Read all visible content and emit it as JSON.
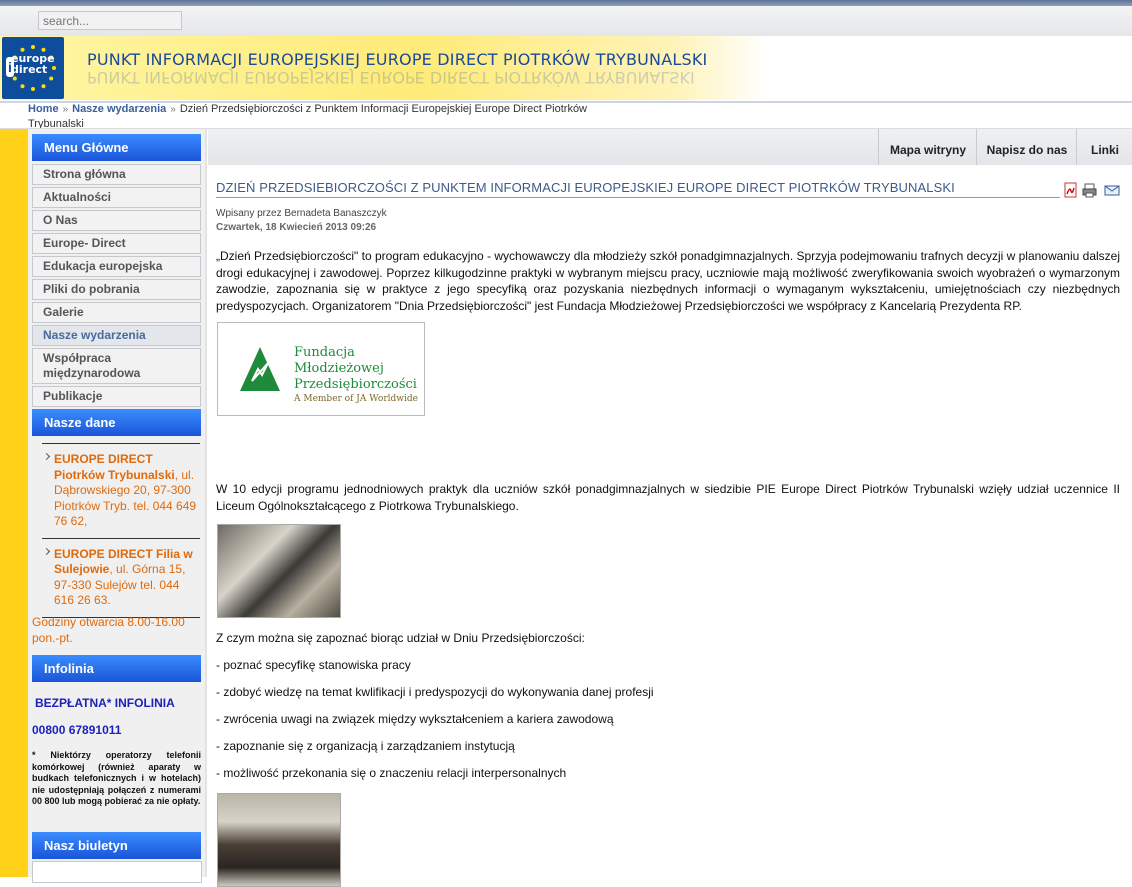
{
  "search": {
    "placeholder": "search..."
  },
  "logo": {
    "line1": "europe",
    "line2": "direct"
  },
  "site_title": "PUNKT INFORMACJI EUROPEJSKIEJ EUROPE DIRECT PIOTRKÓW TRYBUNALSKI",
  "breadcrumb": {
    "home": "Home",
    "section": "Nasze wydarzenia",
    "current": "Dzień Przedsiębiorczości z Punktem Informacji Europejskiej Europe Direct Piotrków Trybunalski"
  },
  "sidebar": {
    "menu_title": "Menu Główne",
    "menu_items": [
      {
        "label": "Strona główna"
      },
      {
        "label": "Aktualności"
      },
      {
        "label": "O Nas"
      },
      {
        "label": "Europe- Direct"
      },
      {
        "label": "Edukacja europejska"
      },
      {
        "label": "Pliki do pobrania"
      },
      {
        "label": "Galerie"
      },
      {
        "label": "Nasze wydarzenia"
      },
      {
        "label": "Współpraca międzynarodowa"
      },
      {
        "label": "Publikacje"
      }
    ],
    "data_title": "Nasze dane",
    "contacts": [
      {
        "name": "EUROPE DIRECT Piotrków Trybunalski",
        "address": ", ul. Dąbrowskiego 20, 97-300 Piotrków Tryb. tel. 044 649 76 62,"
      },
      {
        "name": "EUROPE DIRECT Filia w Sulejowie",
        "address": ", ul. Górna 15, 97-330 Sulejów tel. 044 616 26 63."
      }
    ],
    "hours": "Godziny otwarcia 8.00-16.00 pon.-pt.",
    "infolinia_title": "Infolinia",
    "infolinia_label": "BEZPŁATNA*  INFOLINIA",
    "infolinia_number": "00800 67891011",
    "infolinia_note": "* Niektórzy operatorzy telefonii komórkowej (również aparaty w budkach telefonicznych i w hotelach) nie udostępniają połączeń z numerami 00 800 lub mogą pobierać za nie opłaty.",
    "newsletter_title": "Nasz biuletyn"
  },
  "top_links": [
    "Mapa witryny",
    "Napisz do nas",
    "Linki"
  ],
  "article": {
    "title": "DZIEŃ PRZEDSIEBIORCZOŚCI Z PUNKTEM INFORMACJI EUROPEJSKIEJ EUROPE DIRECT PIOTRKÓW TRYBUNALSKI",
    "author": "Wpisany przez Bernadeta Banaszczyk",
    "date": "Czwartek, 18 Kwiecień 2013 09:26",
    "intro": "„Dzień Przedsiębiorczości\" to program edukacyjno - wychowawczy dla młodzieży szkół ponadgimnazjalnych. Sprzyja podejmowaniu trafnych decyzji w planowaniu dalszej drogi edukacyjnej i zawodowej. Poprzez kilkugodzinne praktyki w wybranym miejscu pracy, uczniowie mają możliwość zweryfikowania swoich wyobrażeń o wymarzonym zawodzie, zapoznania się w praktyce z jego specyfiką oraz pozyskania niezbędnych informacji o wymaganym wykształceniu, umiejętnościach czy niezbędnych predyspozycjach. Organizatorem \"Dnia Przedsiębiorczości\" jest Fundacja Młodzieżowej Przedsiębiorczości we współpracy z Kancelarią Prezydenta RP.",
    "fund_logo": {
      "line1": "Fundacja",
      "line2": "Młodzieżowej",
      "line3": "Przedsiębiorczości",
      "tagline": "A Member of JA Worldwide"
    },
    "edition": "W 10 edycji programu jednodniowych praktyk dla uczniów szkół ponadgimnazjalnych w siedzibie PIE Europe Direct Piotrków Trybunalski wzięły udział uczennice II Liceum Ogólnokształcącego z Piotrkowa Trybunalskiego.",
    "list_intro": "Z czym można się zapoznać biorąc udział w Dniu Przedsiębiorczości:",
    "list": [
      "- poznać specyfikę stanowiska pracy",
      "- zdobyć wiedzę na temat kwlifikacji i predyspozycji do wykonywania danej profesji",
      "- zwrócenia uwagi na związek między wykształceniem a kariera zawodową",
      "- zapoznanie się z organizacją i zarządzaniem instytucją",
      "- możliwość przekonania się o znaczeniu relacji interpersonalnych"
    ]
  }
}
